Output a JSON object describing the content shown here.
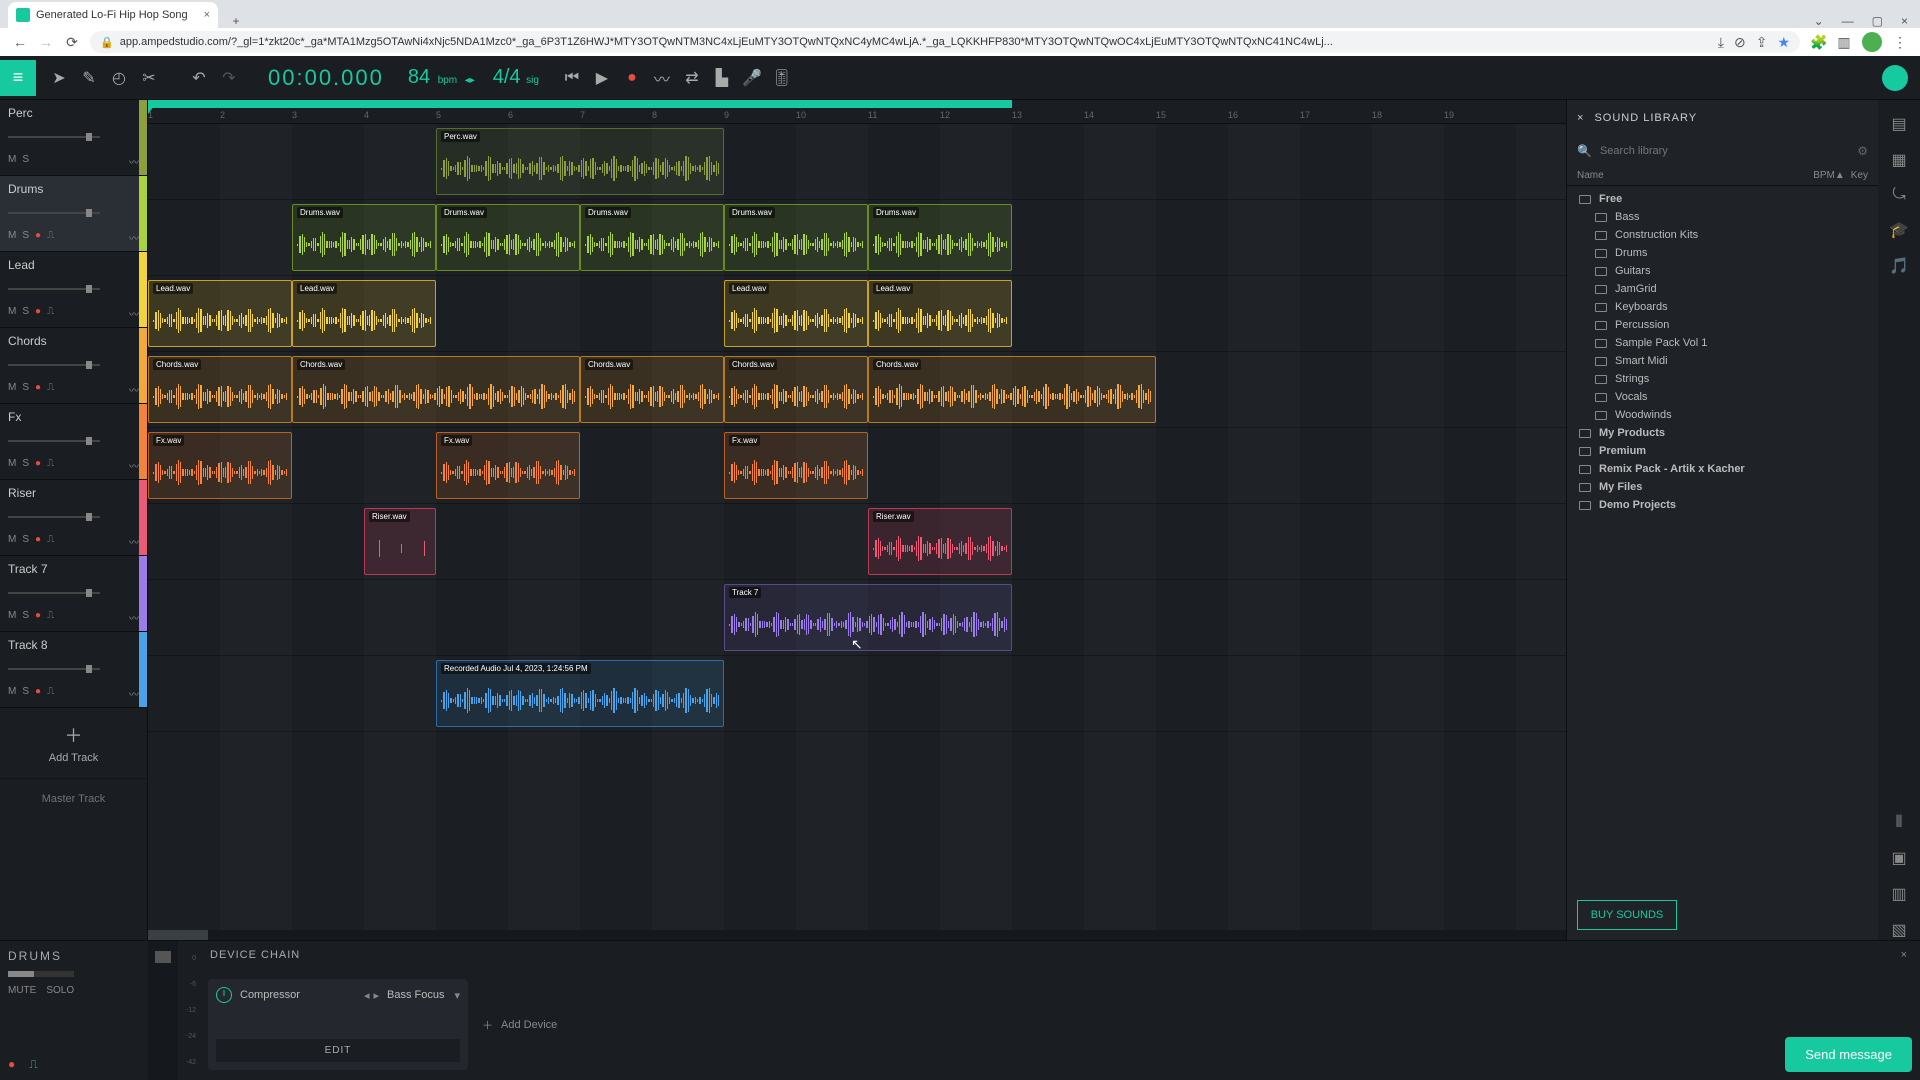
{
  "browser_tab_title": "Generated Lo-Fi Hip Hop Song",
  "url_display": "app.ampedstudio.com/?_gl=1*zkt20c*_ga*MTA1Mzg5OTAwNi4xNjc5NDA1Mzc0*_ga_6P3T1Z6HWJ*MTY3OTQwNTM3NC4xLjEuMTY3OTQwNTQxNC4yMC4wLjA.*_ga_LQKKHFP830*MTY3OTQwNTQwOC4xLjEuMTY3OTQwNTQxNC41NC4wLj...",
  "transport": {
    "timecode": "00:00.000",
    "bpm_value": "84",
    "bpm_label": "bpm",
    "sig_value": "4/4",
    "sig_label": "sig"
  },
  "tracks": [
    {
      "name": "Perc",
      "color": "#8e9e3a",
      "selected": false,
      "record": false
    },
    {
      "name": "Drums",
      "color": "#a9d23b",
      "selected": true,
      "record": true
    },
    {
      "name": "Lead",
      "color": "#f2d43a",
      "selected": false,
      "record": true
    },
    {
      "name": "Chords",
      "color": "#f2a93a",
      "selected": false,
      "record": true
    },
    {
      "name": "Fx",
      "color": "#f2833a",
      "selected": false,
      "record": true
    },
    {
      "name": "Riser",
      "color": "#e85d75",
      "selected": false,
      "record": true
    },
    {
      "name": "Track 7",
      "color": "#9b7de8",
      "selected": false,
      "record": true
    },
    {
      "name": "Track 8",
      "color": "#4aa3e8",
      "selected": false,
      "record": true
    }
  ],
  "track_btn_m": "M",
  "track_btn_s": "S",
  "add_track": "Add Track",
  "master_track": "Master Track",
  "bar_numbers": [
    "1",
    "2",
    "3",
    "4",
    "5",
    "6",
    "7",
    "8",
    "9",
    "10",
    "11",
    "12",
    "13",
    "14",
    "15",
    "16",
    "17",
    "18",
    "19"
  ],
  "loop_start_bar": 1,
  "loop_end_bar": 13,
  "clips": [
    {
      "track": 0,
      "label": "Perc.wav",
      "start": 5,
      "len": 4,
      "color": "#556b2f"
    },
    {
      "track": 1,
      "label": "Drums.wav",
      "start": 3,
      "len": 2,
      "color": "#6a8c1f"
    },
    {
      "track": 1,
      "label": "Drums.wav",
      "start": 5,
      "len": 2,
      "color": "#6a8c1f"
    },
    {
      "track": 1,
      "label": "Drums.wav",
      "start": 7,
      "len": 2,
      "color": "#6a8c1f"
    },
    {
      "track": 1,
      "label": "Drums.wav",
      "start": 9,
      "len": 2,
      "color": "#6a8c1f"
    },
    {
      "track": 1,
      "label": "Drums.wav",
      "start": 11,
      "len": 2,
      "color": "#6a8c1f"
    },
    {
      "track": 2,
      "label": "Lead.wav",
      "start": 1,
      "len": 2,
      "color": "#c9a21f"
    },
    {
      "track": 2,
      "label": "Lead.wav",
      "start": 3,
      "len": 2,
      "color": "#c9a21f"
    },
    {
      "track": 2,
      "label": "Lead.wav",
      "start": 9,
      "len": 2,
      "color": "#c9a21f"
    },
    {
      "track": 2,
      "label": "Lead.wav",
      "start": 11,
      "len": 2,
      "color": "#c9a21f"
    },
    {
      "track": 3,
      "label": "Chords.wav",
      "start": 1,
      "len": 2,
      "color": "#b77a1f"
    },
    {
      "track": 3,
      "label": "Chords.wav",
      "start": 3,
      "len": 4,
      "color": "#b77a1f"
    },
    {
      "track": 3,
      "label": "Chords.wav",
      "start": 7,
      "len": 2,
      "color": "#b77a1f"
    },
    {
      "track": 3,
      "label": "Chords.wav",
      "start": 9,
      "len": 2,
      "color": "#b77a1f"
    },
    {
      "track": 3,
      "label": "Chords.wav",
      "start": 11,
      "len": 4,
      "color": "#b77a1f"
    },
    {
      "track": 4,
      "label": "Fx.wav",
      "start": 1,
      "len": 2,
      "color": "#b7631f"
    },
    {
      "track": 4,
      "label": "Fx.wav",
      "start": 5,
      "len": 2,
      "color": "#b7631f"
    },
    {
      "track": 4,
      "label": "Fx.wav",
      "start": 9,
      "len": 2,
      "color": "#b7631f"
    },
    {
      "track": 5,
      "label": "Riser.wav",
      "start": 4,
      "len": 1,
      "color": "#b83a56"
    },
    {
      "track": 5,
      "label": "Riser.wav",
      "start": 11,
      "len": 2,
      "color": "#b83a56"
    },
    {
      "track": 6,
      "label": "Track 7",
      "start": 9,
      "len": 4,
      "color": "#5a4a8c"
    },
    {
      "track": 7,
      "label": "Recorded Audio Jul 4, 2023, 1:24:56 PM",
      "start": 5,
      "len": 4,
      "color": "#2c6da6"
    }
  ],
  "sound_library": {
    "title": "SOUND LIBRARY",
    "search_placeholder": "Search library",
    "col_name": "Name",
    "col_bpm": "BPM▲",
    "col_key": "Key",
    "root": "Free",
    "folders": [
      "Bass",
      "Construction Kits",
      "Drums",
      "Guitars",
      "JamGrid",
      "Keyboards",
      "Percussion",
      "Sample Pack Vol 1",
      "Smart Midi",
      "Strings",
      "Vocals",
      "Woodwinds"
    ],
    "extras": [
      "My Products",
      "Premium",
      "Remix Pack - Artik x Kacher",
      "My Files",
      "Demo Projects"
    ],
    "buy": "BUY SOUNDS"
  },
  "bottom": {
    "track": "DRUMS",
    "mute": "MUTE",
    "solo": "SOLO",
    "chain_title": "DEVICE CHAIN",
    "device_name": "Compressor",
    "preset": "Bass Focus",
    "edit": "EDIT",
    "add_device": "Add Device"
  },
  "meter_marks": [
    "0",
    "-6",
    "-12",
    "-24",
    "-42"
  ],
  "send_message": "Send message"
}
